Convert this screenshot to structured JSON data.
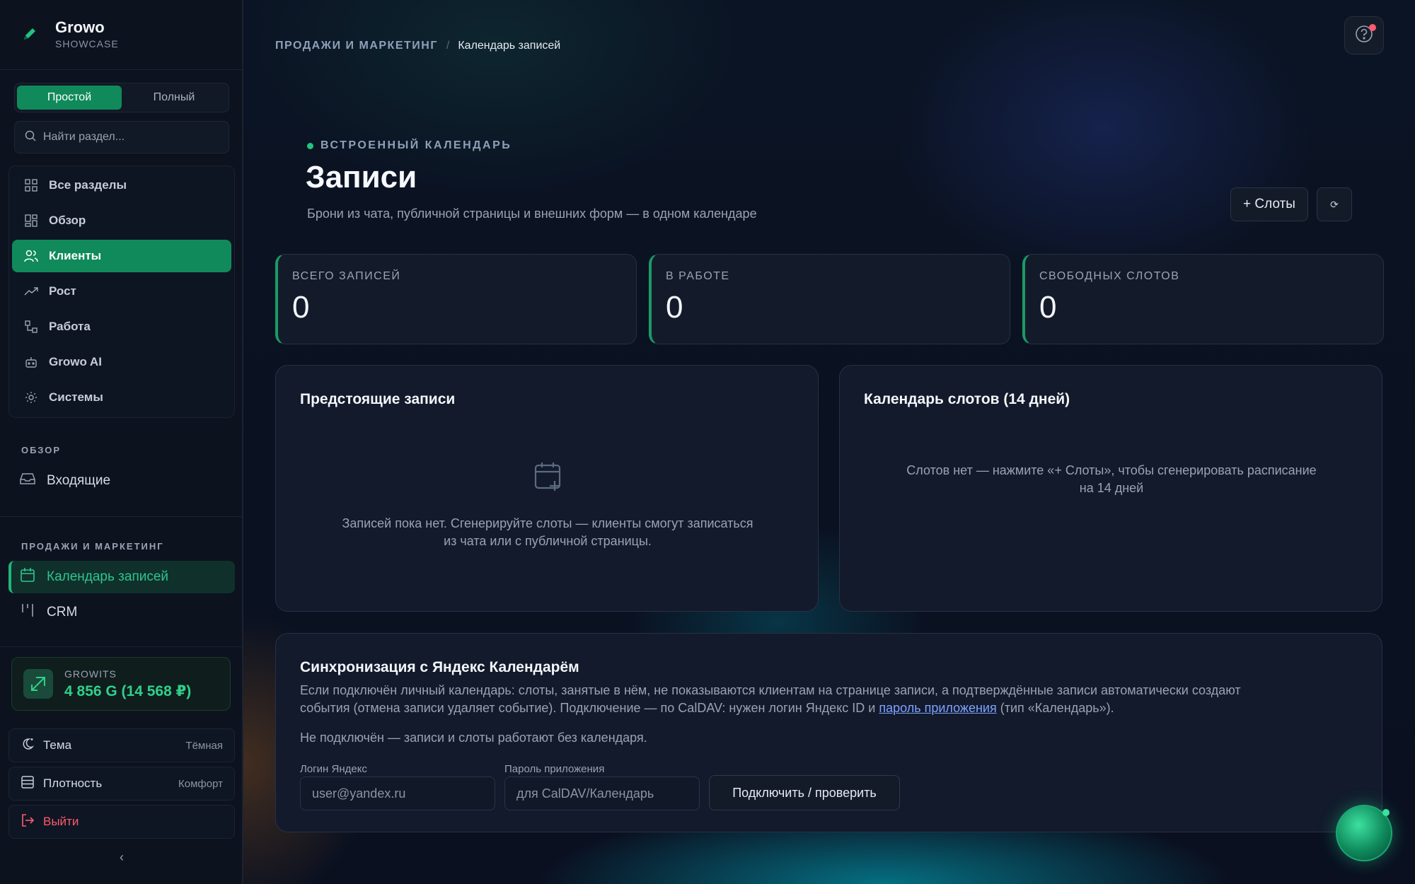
{
  "brand": {
    "name": "Growo",
    "subtitle": "SHOWCASE"
  },
  "mode_switch": {
    "simple": "Простой",
    "full": "Полный"
  },
  "search": {
    "placeholder": "Найти раздел..."
  },
  "nav": {
    "items": [
      {
        "label": "Все разделы",
        "icon": "grid-icon"
      },
      {
        "label": "Обзор",
        "icon": "dashboard-icon"
      },
      {
        "label": "Клиенты",
        "icon": "users-icon",
        "active": true
      },
      {
        "label": "Рост",
        "icon": "trending-up-icon"
      },
      {
        "label": "Работа",
        "icon": "workflow-icon"
      },
      {
        "label": "Growo AI",
        "icon": "bot-icon"
      },
      {
        "label": "Системы",
        "icon": "gear-icon"
      }
    ]
  },
  "sections": {
    "overview": {
      "label": "ОБЗОР",
      "inbox": "Входящие"
    },
    "sales": {
      "label": "ПРОДАЖИ И МАРКЕТИНГ",
      "calendar": "Календарь записей",
      "crm": "CRM"
    }
  },
  "growits": {
    "label": "GROWITS",
    "value": "4 856 G (14 568 ₽)"
  },
  "settings": {
    "theme": {
      "label": "Тема",
      "value": "Тёмная"
    },
    "density": {
      "label": "Плотность",
      "value": "Комфорт"
    },
    "logout": {
      "label": "Выйти"
    }
  },
  "breadcrumb": {
    "root": "ПРОДАЖИ И МАРКЕТИНГ",
    "separator": "/",
    "current": "Календарь записей"
  },
  "header": {
    "eyebrow": "ВСТРОЕННЫЙ КАЛЕНДАРЬ",
    "title": "Записи",
    "subtitle": "Брони из чата, публичной страницы и внешних форм — в одном календаре",
    "slots_button": "+ Слоты",
    "refresh_button": "⟳"
  },
  "stats": [
    {
      "label": "ВСЕГО ЗАПИСЕЙ",
      "value": "0"
    },
    {
      "label": "В РАБОТЕ",
      "value": "0"
    },
    {
      "label": "СВОБОДНЫХ СЛОТОВ",
      "value": "0"
    }
  ],
  "upcoming": {
    "title": "Предстоящие записи",
    "empty_line1": "Записей пока нет. Сгенерируйте слоты — клиенты смогут записаться",
    "empty_line2": "из чата или с публичной страницы."
  },
  "slots_calendar": {
    "title": "Календарь слотов (14 дней)",
    "empty_line1": "Слотов нет — нажмите «+ Слоты», чтобы сгенерировать расписание",
    "empty_line2": "на 14 дней"
  },
  "sync": {
    "title": "Синхронизация с Яндекс Календарём",
    "desc_line1": "Если подключён личный календарь: слоты, занятые в нём, не показываются клиентам на странице записи, а подтверждённые записи автоматически создают",
    "desc_line2_pre": "события (отмена записи удаляет событие). Подключение — по CalDAV: нужен логин Яндекс ID и ",
    "desc_link": "пароль приложения",
    "desc_line2_post": " (тип «Календарь»).",
    "status": "Не подключён — записи и слоты работают без календаря.",
    "login_label": "Логин Яндекс",
    "login_placeholder": "user@yandex.ru",
    "password_label": "Пароль приложения",
    "password_placeholder": "для CalDAV/Календарь",
    "connect_button": "Подключить / проверить"
  },
  "colors": {
    "accent": "#108a5a",
    "accent_text": "#2fd08a",
    "danger": "#ff5a6e",
    "link": "#7fa2ff"
  }
}
